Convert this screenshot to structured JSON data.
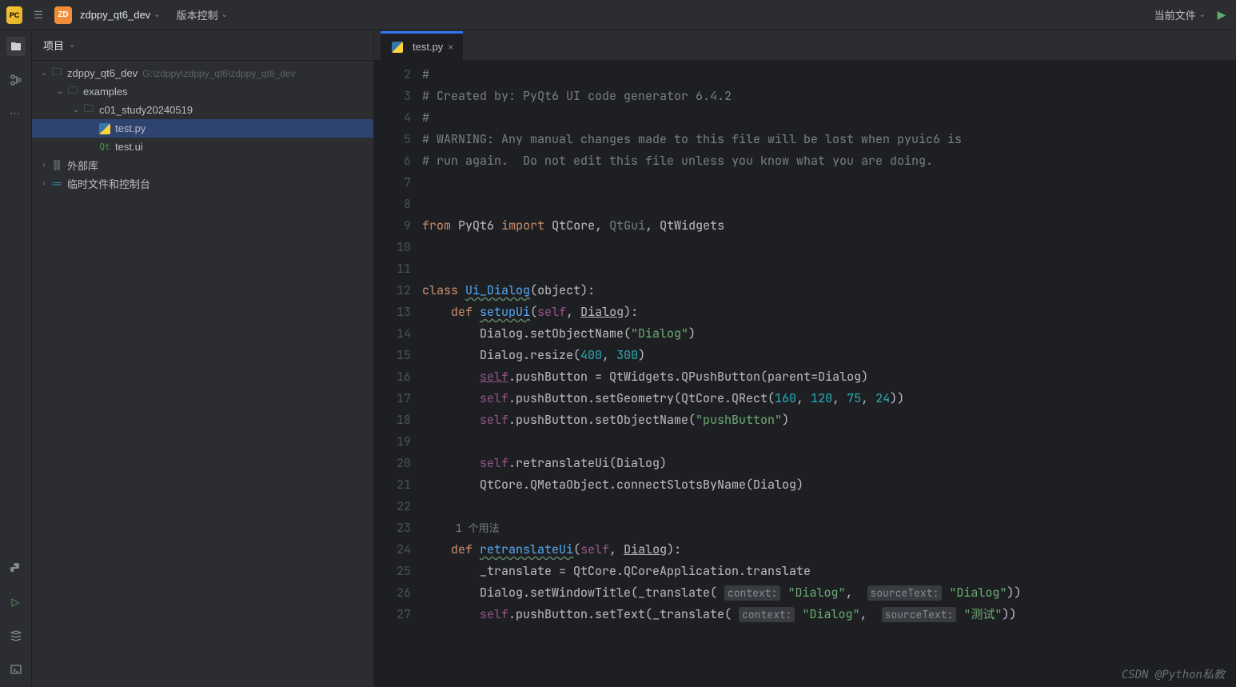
{
  "header": {
    "project_name": "zdppy_qt6_dev",
    "version_control": "版本控制",
    "current_file": "当前文件"
  },
  "project_panel": {
    "title": "项目",
    "root": {
      "label": "zdppy_qt6_dev",
      "path": "G:\\zdppy\\zdppy_qt6\\zdppy_qt6_dev"
    },
    "examples": "examples",
    "study_folder": "c01_study20240519",
    "test_py": "test.py",
    "test_ui": "test.ui",
    "external_libs": "外部库",
    "scratches": "临时文件和控制台"
  },
  "tab": {
    "label": "test.py"
  },
  "gutter": {
    "lines": [
      "2",
      "3",
      "4",
      "5",
      "6",
      "7",
      "8",
      "9",
      "10",
      "11",
      "12",
      "13",
      "14",
      "15",
      "16",
      "17",
      "18",
      "19",
      "20",
      "21",
      "22",
      "",
      "23",
      "24",
      "25",
      "26",
      "27"
    ]
  },
  "code": {
    "l2": "#",
    "l3": "# Created by: PyQt6 UI code generator 6.4.2",
    "l4": "#",
    "l5": "# WARNING: Any manual changes made to this file will be lost when pyuic6 is",
    "l6": "# run again.  Do not edit this file unless you know what you are doing.",
    "l9_from": "from",
    "l9_mod": "PyQt6",
    "l9_imp": "import",
    "l9_qc": "QtCore",
    "l9_qg": "QtGui",
    "l9_qw": "QtWidgets",
    "l12_class": "class",
    "l12_name": "Ui_Dialog",
    "l12_obj": "object",
    "l13_def": "def",
    "l13_name": "setupUi",
    "l13_self": "self",
    "l13_dlg": "Dialog",
    "l14": "Dialog.setObjectName(",
    "l14_s": "\"Dialog\"",
    "l15": "Dialog.resize(",
    "l15_a": "400",
    "l15_b": "300",
    "l16_self": "self",
    "l16_pb": ".pushButton = QtWidgets.QPushButton(",
    "l16_par": "parent",
    "l16_dlg": "=Dialog)",
    "l17_self": "self",
    "l17": ".pushButton.setGeometry(QtCore.QRect(",
    "l17_a": "160",
    "l17_b": "120",
    "l17_c": "75",
    "l17_d": "24",
    "l18_self": "self",
    "l18": ".pushButton.setObjectName(",
    "l18_s": "\"pushButton\"",
    "l20_self": "self",
    "l20": ".retranslateUi(Dialog)",
    "l21": "QtCore.QMetaObject.connectSlotsByName(Dialog)",
    "usage": "1 个用法",
    "l23_def": "def",
    "l23_name": "retranslateUi",
    "l23_self": "self",
    "l23_dlg": "Dialog",
    "l24": "_translate = QtCore.QCoreApplication.translate",
    "l25a": "Dialog.setWindowTitle(_translate(",
    "l25_ctx": "context:",
    "l25_s1": "\"Dialog\"",
    "l25_src": "sourceText:",
    "l25_s2": "\"Dialog\"",
    "l26_self": "self",
    "l26a": ".pushButton.setText(_translate(",
    "l26_ctx": "context:",
    "l26_s1": "\"Dialog\"",
    "l26_src": "sourceText:",
    "l26_s2": "\"测试\""
  },
  "watermark": "CSDN @Python私教"
}
